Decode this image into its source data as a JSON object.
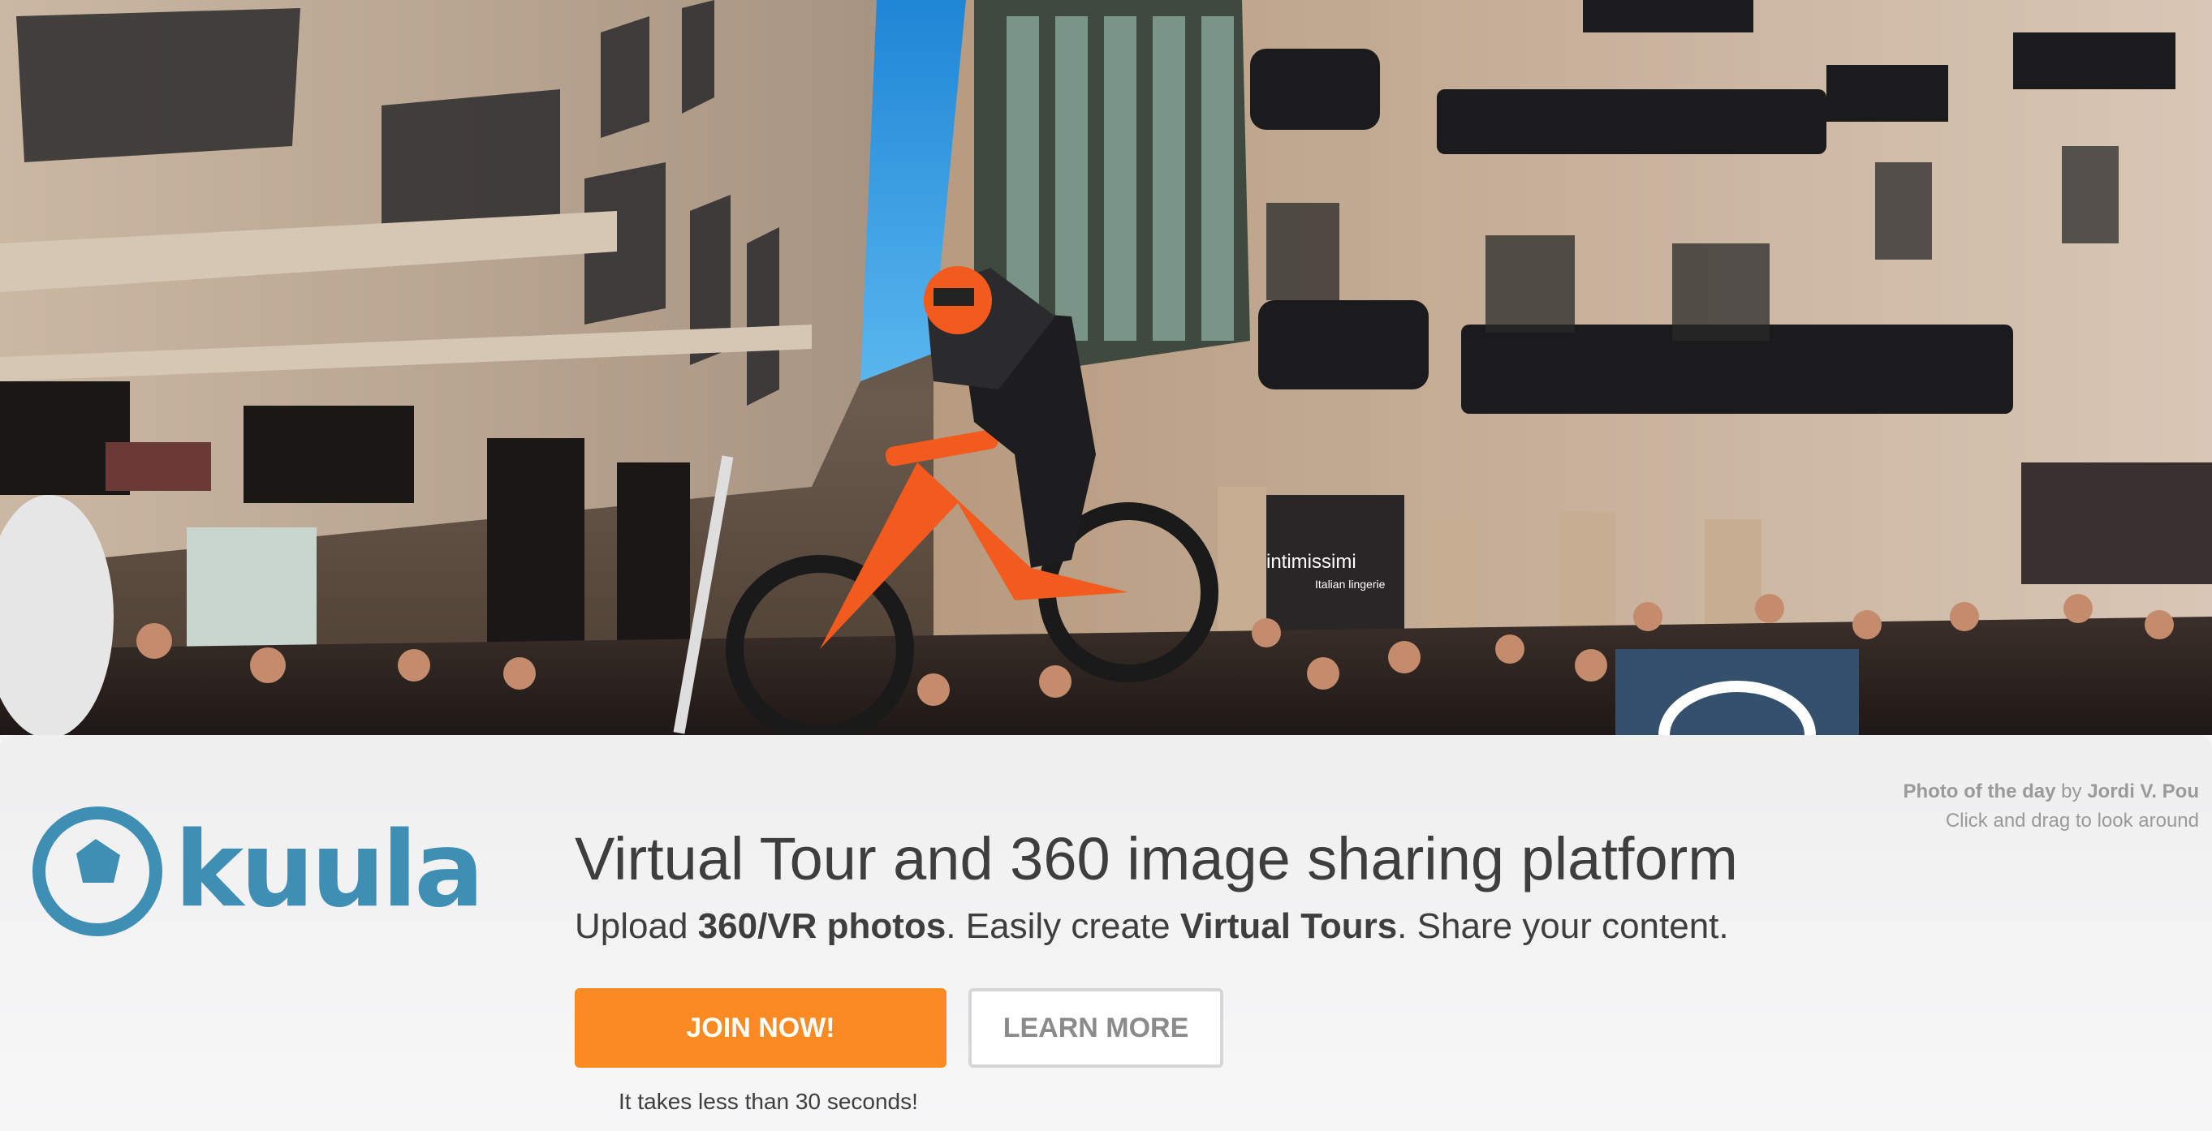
{
  "hero": {
    "banner_text": "intimissimi",
    "banner_subtext": "Italian lingerie"
  },
  "credit": {
    "photo_label": "Photo of the day",
    "by": "by",
    "author": "Jordi V. Pou",
    "hint": "Click and drag to look around"
  },
  "brand": {
    "logo_text": "kuula",
    "color": "#3f8fb4"
  },
  "main": {
    "headline": "Virtual Tour and 360 image sharing platform",
    "subline": {
      "part1": "Upload ",
      "bold1": "360/VR photos",
      "part2": ". Easily create ",
      "bold2": "Virtual Tours",
      "part3": ". Share your content."
    }
  },
  "actions": {
    "join_label": "JOIN NOW!",
    "learn_label": "LEARN MORE",
    "join_color": "#fb8a22",
    "note": "It takes less than 30 seconds!"
  }
}
